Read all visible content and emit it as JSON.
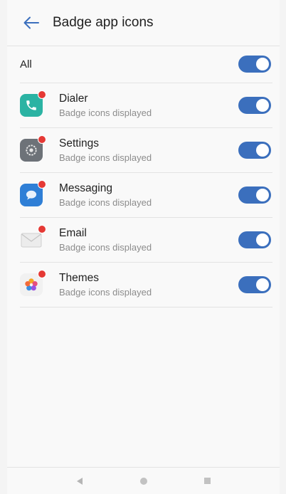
{
  "header": {
    "title": "Badge app icons",
    "back_icon": "arrow-left-icon"
  },
  "all_row": {
    "label": "All",
    "toggle_on": true
  },
  "apps": [
    {
      "name": "Dialer",
      "status": "Badge icons displayed",
      "icon": "phone-icon",
      "color": "#2bb3a3",
      "toggle_on": true
    },
    {
      "name": "Settings",
      "status": "Badge icons displayed",
      "icon": "gear-icon",
      "color": "#6d7278",
      "toggle_on": true
    },
    {
      "name": "Messaging",
      "status": "Badge icons displayed",
      "icon": "chat-bubble-icon",
      "color": "#2f7fd6",
      "toggle_on": true
    },
    {
      "name": "Email",
      "status": "Badge icons displayed",
      "icon": "envelope-icon",
      "color": "#e8e8e8",
      "toggle_on": true
    },
    {
      "name": "Themes",
      "status": "Badge icons displayed",
      "icon": "flower-icon",
      "color": "#f1f1f1",
      "toggle_on": true
    }
  ],
  "colors": {
    "toggle_on": "#3b6fbd",
    "accent": "#3b6fbd",
    "badge": "#e53935"
  },
  "navbar": {
    "back": "triangle-back-icon",
    "home": "circle-home-icon",
    "recents": "square-recents-icon"
  }
}
